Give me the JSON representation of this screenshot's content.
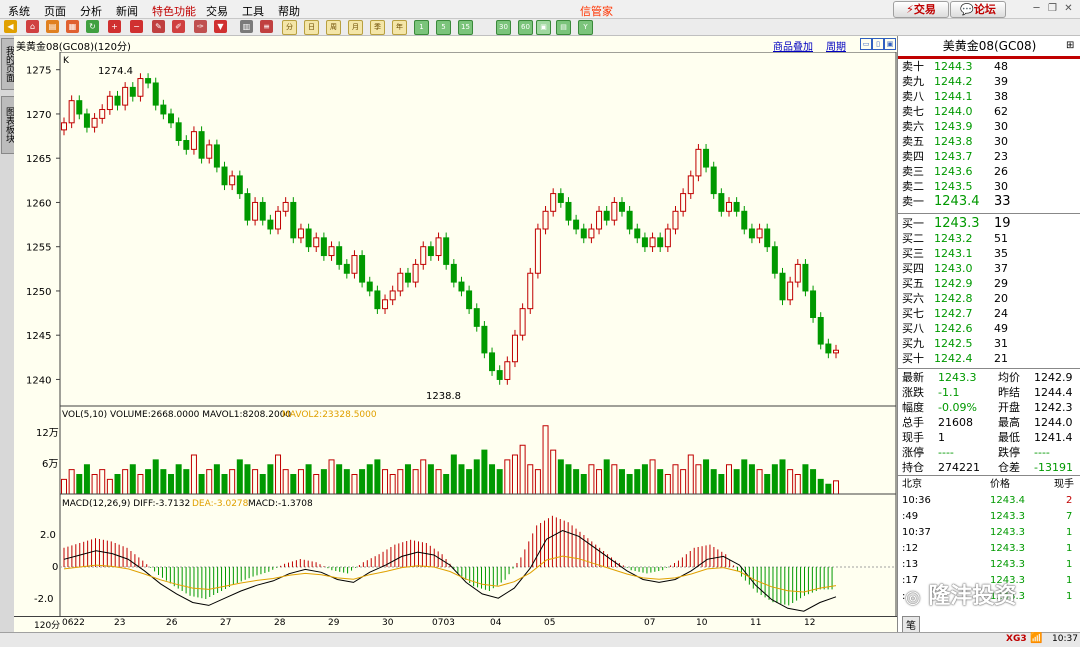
{
  "menu": {
    "items": [
      "系统",
      "页面",
      "分析",
      "新闻",
      "特色功能",
      "交易",
      "工具",
      "帮助"
    ],
    "special_index": 4,
    "brand": "信管家",
    "trade_btn": "交易",
    "forum_btn": "论坛"
  },
  "toolbar": {
    "periods": [
      "分",
      "日",
      "周",
      "月",
      "季",
      "年"
    ],
    "nums": [
      "1",
      "5",
      "15",
      "30",
      "60"
    ],
    "extra": [
      "Y"
    ]
  },
  "sidebar": {
    "tab1": "我的页面",
    "tab2": "图表板块"
  },
  "chart": {
    "title": "美黄金08(GC08)(120分)",
    "links": [
      "商品叠加",
      "周期"
    ],
    "k_label": "K",
    "high_label": "1274.4",
    "low_label": "1238.8",
    "vol_label": "VOL(5,10) VOLUME:2668.0000 MAVOL1:8208.2000",
    "vol_label2": "MAVOL2:23328.5000",
    "vol_ticks": [
      "12万",
      "6万"
    ],
    "macd_label": "MACD(12,26,9) DIFF:-3.7132",
    "macd_dea": "DEA:-3.0278",
    "macd_val": "MACD:-1.3708",
    "macd_ticks": [
      "2.0",
      "0",
      "-2.0"
    ],
    "x_axis": [
      "120分",
      "0622",
      "23",
      "26",
      "27",
      "28",
      "29",
      "30",
      "0703",
      "04",
      "05",
      "07",
      "10",
      "11",
      "12"
    ],
    "colors": {
      "up": "#c00000",
      "down": "#009900",
      "bg": "#fffff0",
      "diff": "#000000",
      "dea": "#e0a000"
    }
  },
  "chart_data": [
    {
      "type": "candlestick",
      "title": "美黄金08(GC08)(120分)",
      "ylim": [
        1237,
        1277
      ],
      "y_ticks": [
        1275,
        1270,
        1265,
        1260,
        1255,
        1250,
        1245,
        1240
      ],
      "high": 1274.4,
      "low": 1238.8,
      "close": [
        1269,
        1271.5,
        1270,
        1268.5,
        1269.5,
        1270.5,
        1272,
        1271,
        1273,
        1272,
        1274,
        1273.5,
        1271,
        1270,
        1269,
        1267,
        1266,
        1268,
        1265,
        1266.5,
        1264,
        1262,
        1263,
        1261,
        1258,
        1260,
        1258,
        1257,
        1259,
        1260,
        1256,
        1257,
        1255,
        1256,
        1254,
        1255,
        1253,
        1252,
        1254,
        1251,
        1250,
        1248,
        1249,
        1250,
        1252,
        1251,
        1253,
        1255,
        1254,
        1256,
        1253,
        1251,
        1250,
        1248,
        1246,
        1243,
        1241,
        1240,
        1242,
        1245,
        1248,
        1252,
        1257,
        1259,
        1261,
        1260,
        1258,
        1257,
        1256,
        1257,
        1259,
        1258,
        1260,
        1259,
        1257,
        1256,
        1255,
        1256,
        1255,
        1257,
        1259,
        1261,
        1263,
        1266,
        1264,
        1261,
        1259,
        1260,
        1259,
        1257,
        1256,
        1257,
        1255,
        1252,
        1249,
        1251,
        1253,
        1250,
        1247,
        1244,
        1243,
        1243.3
      ],
      "volume": [
        3,
        5,
        4,
        6,
        4,
        5,
        3,
        4,
        5,
        6,
        4,
        5,
        7,
        5,
        4,
        6,
        5,
        8,
        4,
        5,
        6,
        4,
        5,
        7,
        6,
        5,
        4,
        6,
        8,
        5,
        4,
        5,
        6,
        4,
        5,
        7,
        6,
        5,
        4,
        5,
        6,
        7,
        5,
        4,
        5,
        6,
        5,
        7,
        6,
        5,
        4,
        8,
        6,
        5,
        7,
        9,
        6,
        5,
        7,
        8,
        10,
        6,
        5,
        14,
        9,
        7,
        6,
        5,
        4,
        6,
        5,
        7,
        6,
        5,
        4,
        5,
        6,
        7,
        5,
        4,
        6,
        5,
        8,
        6,
        7,
        5,
        4,
        6,
        5,
        7,
        6,
        5,
        4,
        6,
        7,
        5,
        4,
        6,
        5,
        3,
        2,
        2.7
      ]
    },
    {
      "type": "bar",
      "series": [
        {
          "name": "MACD",
          "values": [
            1.2,
            1.5,
            1.8,
            1.6,
            1.2,
            0.4,
            -0.5,
            -1.2,
            -1.8,
            -2,
            -1.5,
            -1,
            -0.6,
            -0.3,
            0.2,
            0.5,
            0.3,
            -0.2,
            -0.4,
            0.3,
            0.8,
            1.4,
            1.7,
            1.5,
            0.8,
            -0.4,
            -1.2,
            -1.5,
            -0.8,
            0.6,
            2.6,
            3.2,
            2.8,
            2.0,
            1.2,
            0.4,
            -0.2,
            -0.4,
            -0.2,
            0.4,
            1.2,
            1.4,
            0.8,
            -0.6,
            -1.6,
            -2.2,
            -2.4,
            -1.8,
            -1.4
          ]
        }
      ],
      "ylim": [
        -3.5,
        3.5
      ]
    }
  ],
  "panel": {
    "title": "美黄金08(GC08)",
    "asks": [
      [
        "卖十",
        "1244.3",
        "48"
      ],
      [
        "卖九",
        "1244.2",
        "39"
      ],
      [
        "卖八",
        "1244.1",
        "38"
      ],
      [
        "卖七",
        "1244.0",
        "62"
      ],
      [
        "卖六",
        "1243.9",
        "30"
      ],
      [
        "卖五",
        "1243.8",
        "30"
      ],
      [
        "卖四",
        "1243.7",
        "23"
      ],
      [
        "卖三",
        "1243.6",
        "26"
      ],
      [
        "卖二",
        "1243.5",
        "30"
      ],
      [
        "卖一",
        "1243.4",
        "33"
      ]
    ],
    "bids": [
      [
        "买一",
        "1243.3",
        "19"
      ],
      [
        "买二",
        "1243.2",
        "51"
      ],
      [
        "买三",
        "1243.1",
        "35"
      ],
      [
        "买四",
        "1243.0",
        "37"
      ],
      [
        "买五",
        "1242.9",
        "29"
      ],
      [
        "买六",
        "1242.8",
        "20"
      ],
      [
        "买七",
        "1242.7",
        "24"
      ],
      [
        "买八",
        "1242.6",
        "49"
      ],
      [
        "买九",
        "1242.5",
        "31"
      ],
      [
        "买十",
        "1242.4",
        "21"
      ]
    ],
    "stats": [
      [
        "最新",
        "1243.3",
        "均价",
        "1242.9"
      ],
      [
        "涨跌",
        "-1.1",
        "昨结",
        "1244.4"
      ],
      [
        "幅度",
        "-0.09%",
        "开盘",
        "1242.3"
      ],
      [
        "总手",
        "21608",
        "最高",
        "1244.0"
      ],
      [
        "现手",
        "1",
        "最低",
        "1241.4"
      ],
      [
        "涨停",
        "----",
        "跌停",
        "----"
      ],
      [
        "持仓",
        "274221",
        "仓差",
        "-13191"
      ]
    ],
    "tick_header": [
      "北京",
      "价格",
      "现手"
    ],
    "ticks": [
      [
        "10:36",
        "1243.4",
        "2"
      ],
      [
        ":49",
        "1243.3",
        "7"
      ],
      [
        "10:37",
        "1243.3",
        "1"
      ],
      [
        ":12",
        "1243.3",
        "1"
      ],
      [
        ":13",
        "1243.3",
        "1"
      ],
      [
        ":17",
        "1243.3",
        "1"
      ],
      [
        ":",
        "1243.3",
        "1"
      ]
    ],
    "watermark": "隆沣投资"
  },
  "status": {
    "time": "10:37",
    "logo": "XG3"
  }
}
